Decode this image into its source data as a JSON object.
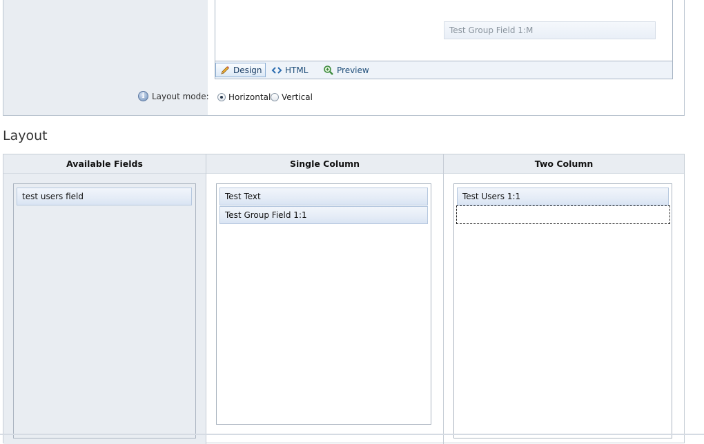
{
  "editor": {
    "ghost_field_label": "Test Group Field 1:M",
    "toolbar": {
      "design_label": "Design",
      "html_label": "HTML",
      "preview_label": "Preview"
    }
  },
  "layout_mode": {
    "label": "Layout mode:",
    "options": [
      {
        "label": "Horizontal",
        "checked": true
      },
      {
        "label": "Vertical",
        "checked": false
      }
    ]
  },
  "layout": {
    "heading": "Layout",
    "columns": [
      {
        "title": "Available Fields",
        "items": [
          "test users field"
        ]
      },
      {
        "title": "Single Column",
        "items": [
          "Test Text",
          "Test Group Field 1:1"
        ]
      },
      {
        "title": "Two Column",
        "items": [
          "Test Users 1:1"
        ]
      }
    ]
  }
}
